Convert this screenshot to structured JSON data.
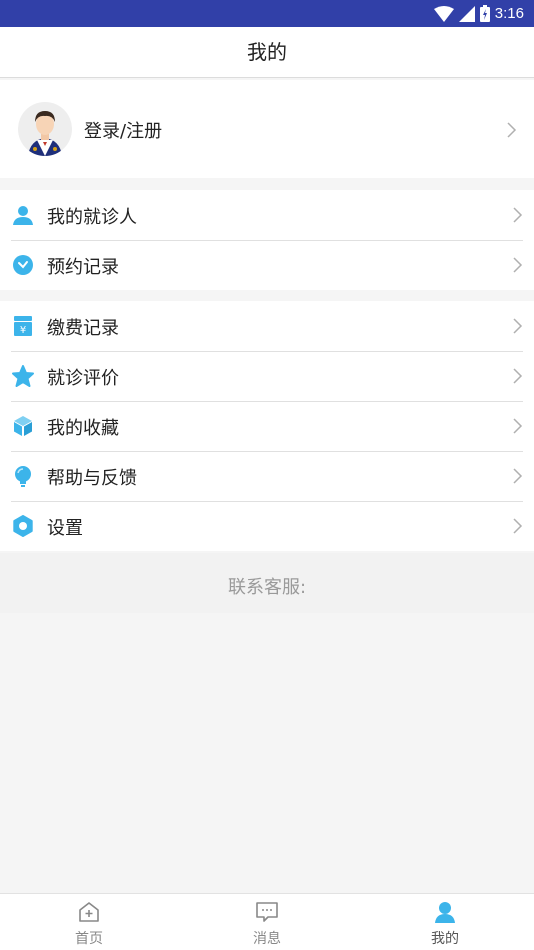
{
  "status_bar": {
    "time": "3:16"
  },
  "header": {
    "title": "我的"
  },
  "profile": {
    "login_label": "登录/注册"
  },
  "menu_group_1": [
    {
      "label": "我的就诊人",
      "icon": "person-icon"
    },
    {
      "label": "预约记录",
      "icon": "clock-icon"
    }
  ],
  "menu_group_2": [
    {
      "label": "缴费记录",
      "icon": "payment-icon"
    },
    {
      "label": "就诊评价",
      "icon": "star-icon"
    },
    {
      "label": "我的收藏",
      "icon": "cube-icon"
    },
    {
      "label": "帮助与反馈",
      "icon": "bulb-icon"
    },
    {
      "label": "设置",
      "icon": "settings-icon"
    }
  ],
  "contact": {
    "label": "联系客服:"
  },
  "tabbar": [
    {
      "label": "首页",
      "icon": "home-icon",
      "active": false
    },
    {
      "label": "消息",
      "icon": "message-icon",
      "active": false
    },
    {
      "label": "我的",
      "icon": "profile-icon",
      "active": true
    }
  ],
  "colors": {
    "status_bar": "#3140a8",
    "icon_blue": "#3cb4ea",
    "divider": "#e0e0e0"
  }
}
